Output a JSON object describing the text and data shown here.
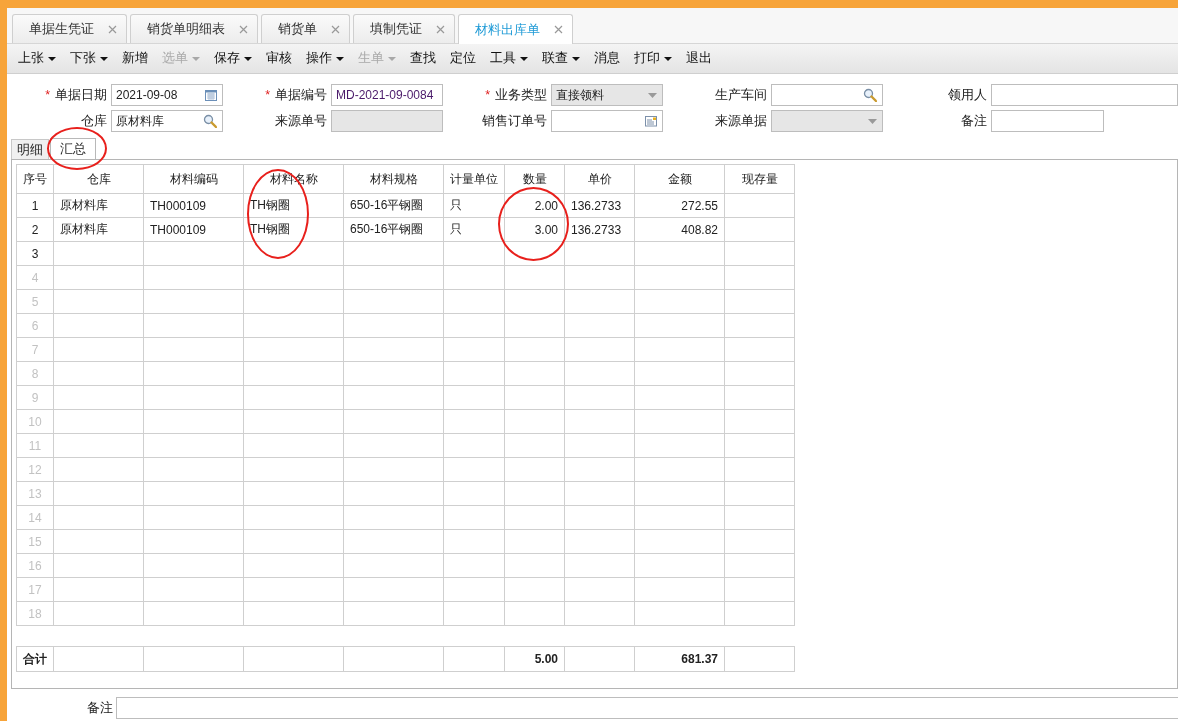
{
  "tabs": [
    {
      "label": "单据生凭证",
      "selected": false
    },
    {
      "label": "销货单明细表",
      "selected": false
    },
    {
      "label": "销货单",
      "selected": false
    },
    {
      "label": "填制凭证",
      "selected": false
    },
    {
      "label": "材料出库单",
      "selected": true
    }
  ],
  "toolbar": [
    {
      "label": "上张",
      "dropdown": true,
      "disabled": false
    },
    {
      "label": "下张",
      "dropdown": true,
      "disabled": false
    },
    {
      "label": "新增",
      "dropdown": false,
      "disabled": false
    },
    {
      "label": "选单",
      "dropdown": true,
      "disabled": true
    },
    {
      "label": "保存",
      "dropdown": true,
      "disabled": false
    },
    {
      "label": "审核",
      "dropdown": false,
      "disabled": false
    },
    {
      "label": "操作",
      "dropdown": true,
      "disabled": false
    },
    {
      "label": "生单",
      "dropdown": true,
      "disabled": true
    },
    {
      "label": "查找",
      "dropdown": false,
      "disabled": false
    },
    {
      "label": "定位",
      "dropdown": false,
      "disabled": false
    },
    {
      "label": "工具",
      "dropdown": true,
      "disabled": false
    },
    {
      "label": "联查",
      "dropdown": true,
      "disabled": false
    },
    {
      "label": "消息",
      "dropdown": false,
      "disabled": false
    },
    {
      "label": "打印",
      "dropdown": true,
      "disabled": false
    },
    {
      "label": "退出",
      "dropdown": false,
      "disabled": false
    }
  ],
  "form": {
    "rows": [
      [
        {
          "label": "单据日期",
          "required_mark": "*",
          "kind": "date",
          "value": "2021-09-08"
        },
        {
          "label": "单据编号",
          "required_mark": "*",
          "kind": "text",
          "value": "MD-2021-09-0084"
        },
        {
          "label": "业务类型",
          "required_mark": "*",
          "kind": "select",
          "value": "直接领料",
          "disabled": true
        },
        {
          "label": "生产车间",
          "kind": "lookup"
        },
        {
          "label": "领用人",
          "kind": "wide"
        }
      ],
      [
        {
          "label": "仓库",
          "kind": "lookup",
          "value": "原材料库"
        },
        {
          "label": "来源单号",
          "kind": "readonly"
        },
        {
          "label": "销售订单号",
          "kind": "picker"
        },
        {
          "label": "来源单据",
          "kind": "select",
          "disabled": true
        },
        {
          "label": "备注",
          "kind": "text"
        }
      ]
    ]
  },
  "sub_tabs": [
    {
      "label": "明细",
      "selected": false,
      "circled": false
    },
    {
      "label": "汇总",
      "selected": true,
      "circled": true
    }
  ],
  "grid": {
    "columns": [
      {
        "label": "序号",
        "circled": false
      },
      {
        "label": "仓库",
        "circled": false
      },
      {
        "label": "材料编码",
        "circled": false
      },
      {
        "label": "材料名称",
        "circled": true
      },
      {
        "label": "材料规格",
        "circled": false
      },
      {
        "label": "计量单位",
        "circled": false
      },
      {
        "label": "数量",
        "circled": true
      },
      {
        "label": "单价",
        "circled": false
      },
      {
        "label": "金额",
        "circled": false
      },
      {
        "label": "现存量",
        "circled": false
      }
    ],
    "rows": [
      {
        "no": "1",
        "cells": [
          "原材料库",
          "TH000109",
          "TH钢圈",
          "650-16平钢圈",
          "只",
          "2.00",
          "136.2733",
          "272.55"
        ],
        "disabled": false
      },
      {
        "no": "2",
        "cells": [
          "原材料库",
          "TH000109",
          "TH钢圈",
          "650-16平钢圈",
          "只",
          "3.00",
          "136.2733",
          "408.82"
        ],
        "disabled": false
      },
      {
        "no": "3",
        "disabled": false
      },
      {
        "no": "4",
        "disabled": true
      },
      {
        "no": "5",
        "disabled": true
      },
      {
        "no": "6",
        "disabled": true
      },
      {
        "no": "7",
        "disabled": true
      },
      {
        "no": "8",
        "disabled": true
      },
      {
        "no": "9",
        "disabled": true
      },
      {
        "no": "10",
        "disabled": true
      },
      {
        "no": "11",
        "disabled": true
      },
      {
        "no": "12",
        "disabled": true
      },
      {
        "no": "13",
        "disabled": true
      },
      {
        "no": "14",
        "disabled": true
      },
      {
        "no": "15",
        "disabled": true
      },
      {
        "no": "16",
        "disabled": true
      },
      {
        "no": "17",
        "disabled": true
      },
      {
        "no": "18",
        "disabled": true
      }
    ],
    "totals": {
      "label": "合计",
      "quantity": "5.00",
      "amount": "681.37"
    }
  },
  "remark": {
    "label": "备注"
  }
}
